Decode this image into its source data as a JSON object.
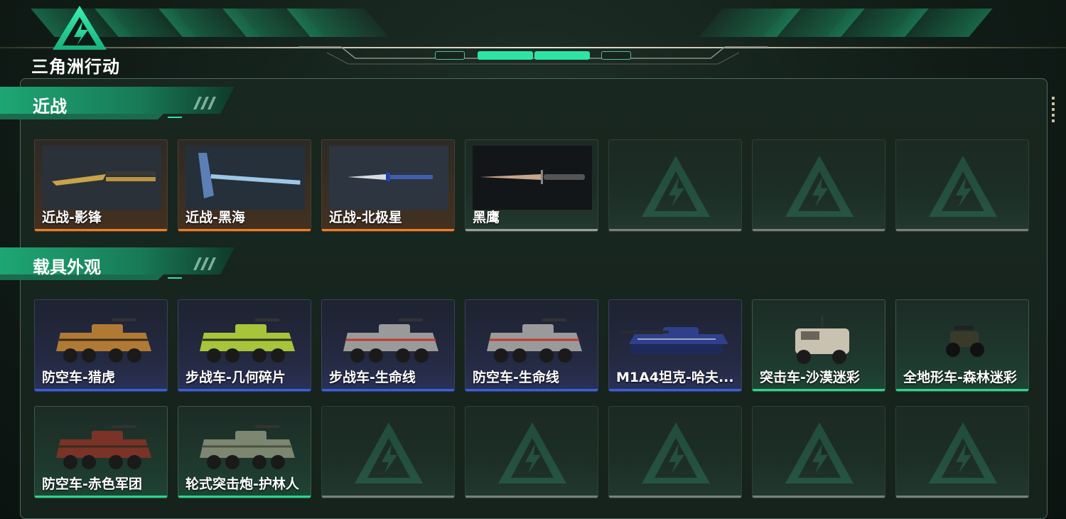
{
  "header": {
    "logo_text": "三角洲行动",
    "icon": "delta-triangle-logo"
  },
  "sections": [
    {
      "title": "近战",
      "cards": [
        {
          "name": "近战-影锋",
          "rarity": "orange",
          "icon": "butterfly-knife"
        },
        {
          "name": "近战-黑海",
          "rarity": "orange",
          "icon": "ice-axe"
        },
        {
          "name": "近战-北极星",
          "rarity": "orange",
          "icon": "dagger"
        },
        {
          "name": "黑鹰",
          "rarity": "grey",
          "icon": "combat-knife"
        },
        {
          "name": "",
          "rarity": "empty"
        },
        {
          "name": "",
          "rarity": "empty"
        },
        {
          "name": "",
          "rarity": "empty"
        }
      ]
    },
    {
      "title": "载具外观",
      "cards": [
        {
          "name": "防空车-猎虎",
          "rarity": "blue",
          "icon": "apc-tiger"
        },
        {
          "name": "步战车-几何碎片",
          "rarity": "blue",
          "icon": "ifv-geometric"
        },
        {
          "name": "步战车-生命线",
          "rarity": "blue",
          "icon": "ifv-lifeline"
        },
        {
          "name": "防空车-生命线",
          "rarity": "blue",
          "icon": "aa-lifeline"
        },
        {
          "name": "M1A4坦克-哈夫...",
          "rarity": "blue",
          "icon": "tank"
        },
        {
          "name": "突击车-沙漠迷彩",
          "rarity": "green",
          "icon": "assault-vehicle"
        },
        {
          "name": "全地形车-森林迷彩",
          "rarity": "green",
          "icon": "atv"
        },
        {
          "name": "防空车-赤色军团",
          "rarity": "green",
          "icon": "aa-red"
        },
        {
          "name": "轮式突击炮-护林人",
          "rarity": "green",
          "icon": "wheeled-gun"
        },
        {
          "name": "",
          "rarity": "empty"
        },
        {
          "name": "",
          "rarity": "empty"
        },
        {
          "name": "",
          "rarity": "empty"
        },
        {
          "name": "",
          "rarity": "empty"
        },
        {
          "name": "",
          "rarity": "empty"
        }
      ]
    }
  ],
  "colors": {
    "orange": "#f07d1e",
    "blue": "#3460e6",
    "green": "#2ad68a",
    "grey": "#9a9e9c",
    "accent": "#2ee4a5"
  }
}
